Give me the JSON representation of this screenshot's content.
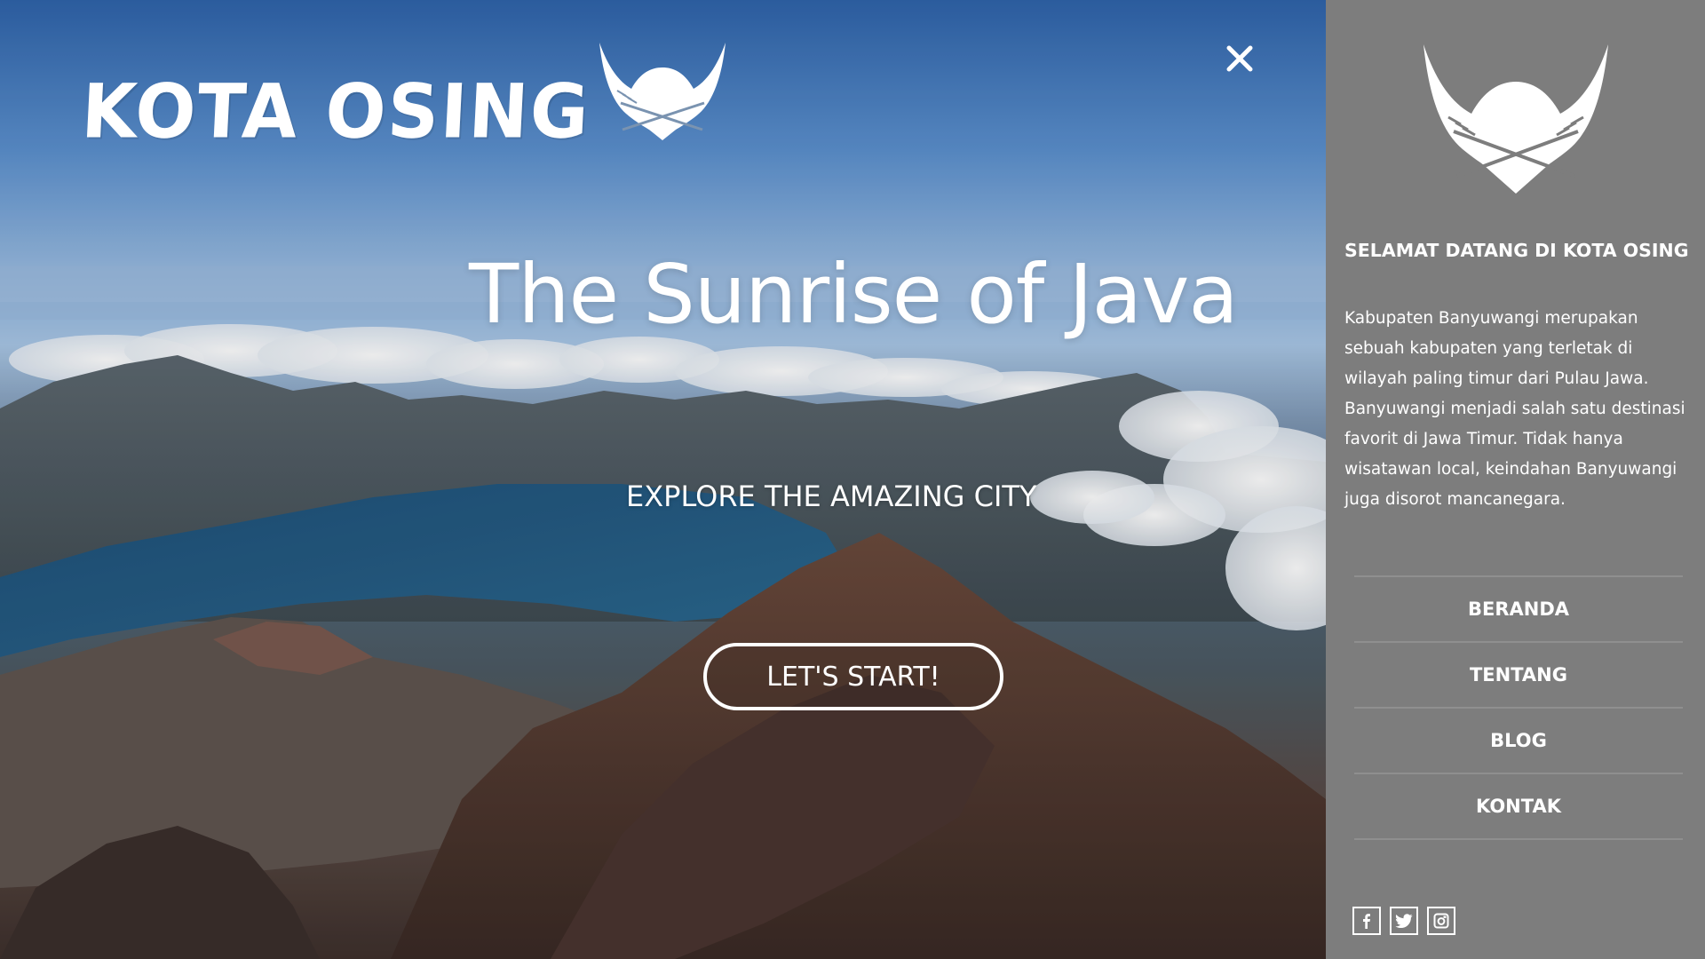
{
  "brand": {
    "name": "KOTA OSING",
    "logo_icon": "horned-helmet-icon"
  },
  "hero": {
    "title": "The Sunrise of Java",
    "subtitle": "EXPLORE THE AMAZING CITY",
    "cta_label": "LET'S START!",
    "close_icon": "close-icon"
  },
  "sidebar": {
    "heading": "SELAMAT DATANG DI KOTA OSING",
    "description": "Kabupaten Banyuwangi merupakan sebuah kabupaten yang terletak di wilayah paling timur dari Pulau Jawa. Banyuwangi menjadi salah satu destinasi favorit di Jawa Timur. Tidak hanya wisatawan local, keindahan Banyuwangi juga disorot mancanegara.",
    "nav": [
      {
        "label": "BERANDA"
      },
      {
        "label": "TENTANG"
      },
      {
        "label": "BLOG"
      },
      {
        "label": "KONTAK"
      }
    ],
    "social": [
      {
        "icon": "facebook-icon"
      },
      {
        "icon": "twitter-icon"
      },
      {
        "icon": "instagram-icon"
      }
    ]
  },
  "colors": {
    "sidebar_bg": "#7d7d7d",
    "text": "#ffffff"
  }
}
